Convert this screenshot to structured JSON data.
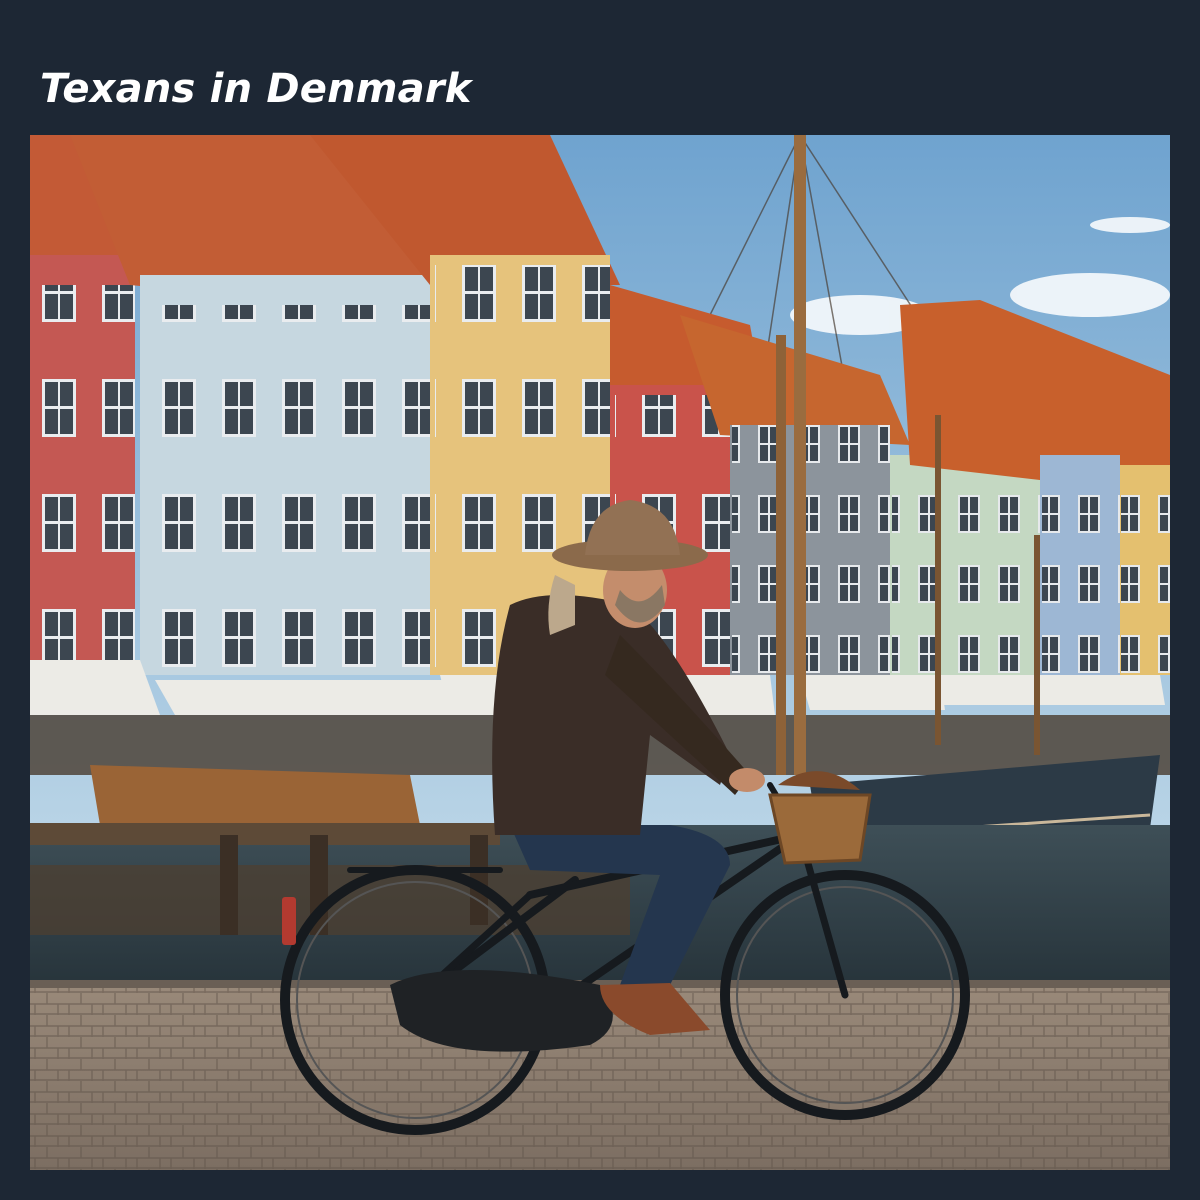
{
  "page": {
    "title": "Texans in Denmark",
    "background_color": "#1d2734",
    "title_color": "#ffffff"
  },
  "photo": {
    "kind": "photograph",
    "elements": [
      "sky",
      "harbor-houses",
      "sailboat-mast",
      "canal-water",
      "cobblestones",
      "cyclist",
      "bicycle"
    ]
  }
}
